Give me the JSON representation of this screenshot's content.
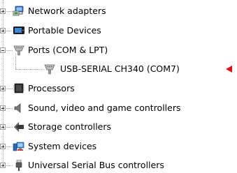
{
  "tree": {
    "items": [
      {
        "label": "Network adapters",
        "state": "collapsed",
        "icon": "network-adapter-icon"
      },
      {
        "label": "Portable Devices",
        "state": "collapsed",
        "icon": "portable-device-icon"
      },
      {
        "label": "Ports (COM & LPT)",
        "state": "expanded",
        "icon": "port-icon",
        "children": [
          {
            "label": "USB-SERIAL CH340 (COM7)",
            "icon": "usb-serial-port-icon",
            "highlighted": true
          }
        ]
      },
      {
        "label": "Processors",
        "state": "collapsed",
        "icon": "processor-icon"
      },
      {
        "label": "Sound, video and game controllers",
        "state": "collapsed",
        "icon": "speaker-icon"
      },
      {
        "label": "Storage controllers",
        "state": "collapsed",
        "icon": "storage-controller-icon"
      },
      {
        "label": "System devices",
        "state": "collapsed",
        "icon": "system-devices-icon"
      },
      {
        "label": "Universal Serial Bus controllers",
        "state": "collapsed",
        "icon": "usb-plug-icon"
      }
    ]
  },
  "annotation": {
    "arrow_color": "#e0101a",
    "icon": "red-pointer-arrow-icon"
  }
}
